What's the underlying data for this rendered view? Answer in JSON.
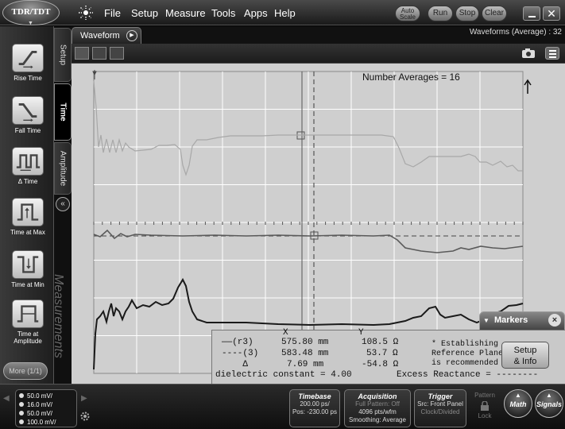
{
  "app": {
    "mode_label": "TDR/TDT"
  },
  "menu": [
    "File",
    "Setup",
    "Measure",
    "Tools",
    "Apps",
    "Help"
  ],
  "top_buttons": {
    "auto_scale_line1": "Auto",
    "auto_scale_line2": "Scale",
    "run": "Run",
    "stop": "Stop",
    "clear": "Clear",
    "close_glyph": "✕"
  },
  "side_tabs": {
    "setup": "Setup",
    "time": "Time",
    "amplitude": "Amplitude",
    "measurements": "Measurements"
  },
  "tools": [
    {
      "label": "Rise Time"
    },
    {
      "label": "Fall Time"
    },
    {
      "label": "Δ Time"
    },
    {
      "label": "Time at Max"
    },
    {
      "label": "Time at Min"
    },
    {
      "label": "Time at Amplitude"
    }
  ],
  "more_button": "More (1/1)",
  "waveform": {
    "tab_label": "Waveform",
    "status": "Waveforms (Average) : 32",
    "number_averages": "Number Averages = 16"
  },
  "markers": {
    "title": "Markers",
    "col_x": "X",
    "col_y": "Y",
    "rows": [
      {
        "label": "——(r3)",
        "x": "575.80 mm",
        "y": "108.5 Ω"
      },
      {
        "label": "----(3)",
        "x": "583.48 mm",
        "y": "53.7 Ω"
      },
      {
        "label": "    Δ",
        "x": "7.69 mm",
        "y": "-54.8 Ω"
      }
    ],
    "footer_left": "dielectric constant = 4.00",
    "footer_right": "Excess Reactance = --------",
    "note_1": "* Establishing",
    "note_2": "Reference Plane",
    "note_3": "is recommended",
    "setup_info_1": "Setup",
    "setup_info_2": "& Info"
  },
  "channels": [
    {
      "scale": "50.0 mV/"
    },
    {
      "scale": "16.0 mV/"
    },
    {
      "scale": "50.0 mV/"
    },
    {
      "scale": "100.0 mV/"
    }
  ],
  "timebase": {
    "title": "Timebase",
    "line1": "200.00 ps/",
    "line2": "Pos: -230.00 ps"
  },
  "acquisition": {
    "title": "Acquisition",
    "line1": "Full Pattern: Off",
    "line2": "4096 pts/wfm",
    "line3": "Smoothing: Average"
  },
  "trigger": {
    "title": "Trigger",
    "line1": "Src: Front Panel",
    "line2": "Clock/Divided"
  },
  "pattern": {
    "label": "Pattern",
    "lock": "Lock"
  },
  "round_buttons": {
    "math": "Math",
    "signals": "Signals"
  },
  "colors": {
    "plot_bg": "#cfcfcf",
    "grid": "#ffffff",
    "trace_light": "#a8a8a8",
    "trace_mid": "#5a5a5a",
    "trace_dark": "#1a1a1a"
  }
}
